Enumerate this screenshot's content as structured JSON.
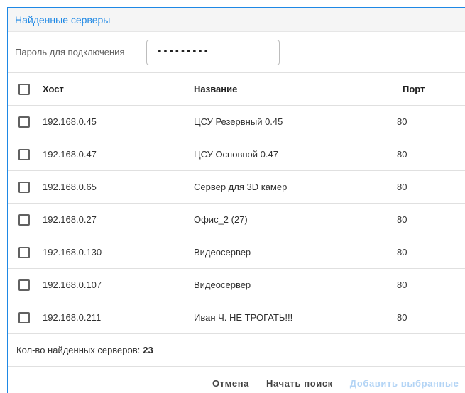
{
  "dialog": {
    "title": "Найденные серверы",
    "password_label": "Пароль для подключения",
    "password_value": "•••••••••"
  },
  "table": {
    "headers": {
      "host": "Хост",
      "name": "Название",
      "port": "Порт"
    },
    "rows": [
      {
        "host": "192.168.0.45",
        "name": "ЦСУ Резервный 0.45",
        "port": "80",
        "checked": false
      },
      {
        "host": "192.168.0.47",
        "name": "ЦСУ Основной 0.47",
        "port": "80",
        "checked": false
      },
      {
        "host": "192.168.0.65",
        "name": "Сервер для 3D камер",
        "port": "80",
        "checked": false
      },
      {
        "host": "192.168.0.27",
        "name": "Офис_2 (27)",
        "port": "80",
        "checked": false
      },
      {
        "host": "192.168.0.130",
        "name": "Видеосервер",
        "port": "80",
        "checked": false
      },
      {
        "host": "192.168.0.107",
        "name": "Видеосервер",
        "port": "80",
        "checked": false
      },
      {
        "host": "192.168.0.211",
        "name": "Иван Ч. НЕ ТРОГАТЬ!!!",
        "port": "80",
        "checked": false
      }
    ]
  },
  "footer": {
    "count_label": "Кол-во найденных серверов:",
    "count_value": "23"
  },
  "actions": {
    "cancel": "Отмена",
    "start_search": "Начать поиск",
    "add_selected": "Добавить выбранные"
  },
  "colors": {
    "accent": "#1e88e5",
    "disabled_text": "#b3d4f5"
  }
}
